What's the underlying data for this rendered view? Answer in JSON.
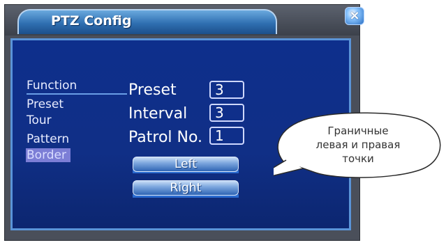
{
  "window": {
    "title": "PTZ Config",
    "close_glyph": "×"
  },
  "menu": {
    "items": [
      {
        "label": "Function"
      },
      {
        "label": "Preset"
      },
      {
        "label": "Tour"
      },
      {
        "label": "Pattern"
      },
      {
        "label": "Border",
        "selected": true
      }
    ]
  },
  "fields": {
    "preset": {
      "label": "Preset",
      "value": "3"
    },
    "interval": {
      "label": "Interval",
      "value": "3"
    },
    "patrol_no": {
      "label": "Patrol No.",
      "value": "1"
    }
  },
  "buttons": {
    "left": "Left",
    "right": "Right"
  },
  "annotation": {
    "line1": "Граничные",
    "line2": "левая и правая",
    "line3": "точки"
  },
  "colors": {
    "panel_bg": "#102f86",
    "panel_border": "#5a94d8",
    "selected_item_bg": "#7c7ed6",
    "button_gradient_top": "#c9ddf6",
    "button_gradient_bottom": "#2e64b4"
  }
}
